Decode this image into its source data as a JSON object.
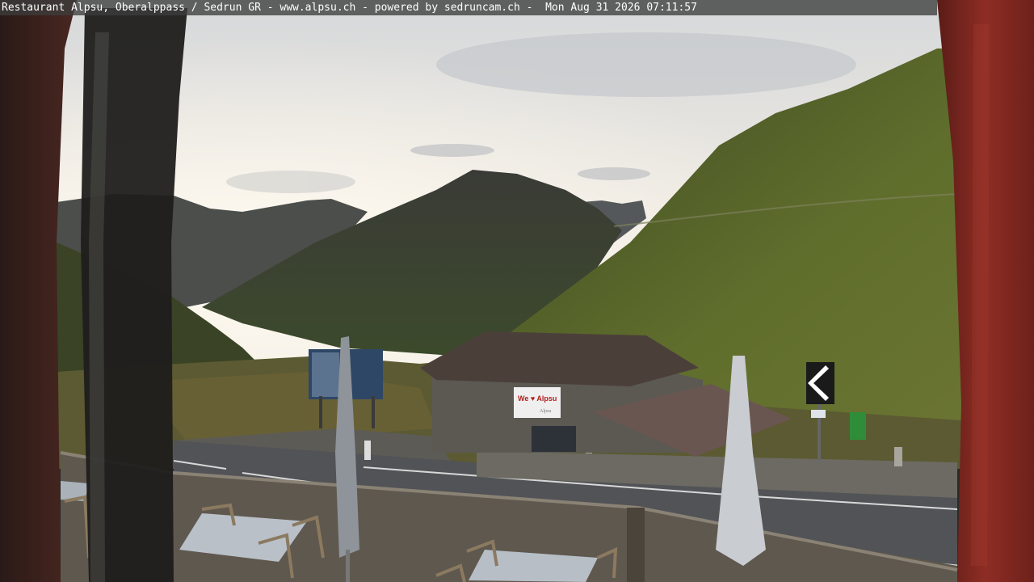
{
  "overlay": {
    "caption": "Restaurant Alpsu, Oberalppass / Sedrun GR - www.alpsu.ch - powered by sedruncam.ch -  Mon Aug 31 2026 07:11:57"
  },
  "scene": {
    "hut_sign": "We ♥ Alpsu",
    "hut_sign_sub": "Alpsu"
  },
  "colors": {
    "sky_bright": "#f6f1e6",
    "sky_grey": "#c9ccd0",
    "mountain_far": "#4a4d49",
    "mountain_mid": "#3d4a33",
    "slope_green": "#5d6b2d",
    "road": "#4f5155",
    "frame_red": "#8a2a22"
  }
}
